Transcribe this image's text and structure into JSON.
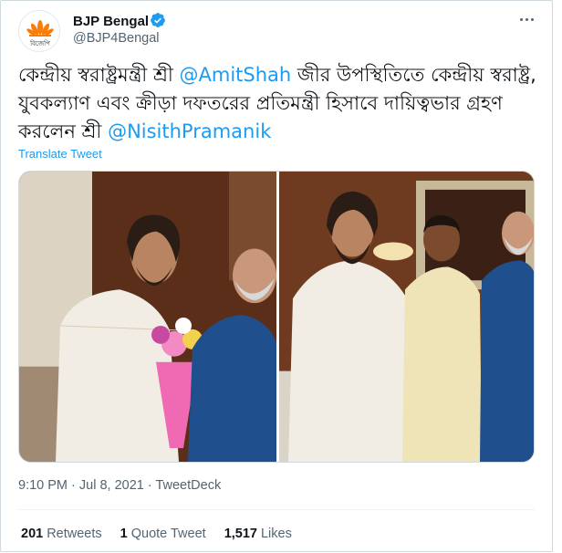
{
  "author": {
    "display_name": "BJP Bengal",
    "handle": "@BJP4Bengal",
    "avatar_text": "বিজেপি",
    "verified": true
  },
  "tweet": {
    "text_part1": "কেন্দ্রীয় স্বরাষ্ট্রমন্ত্রী শ্রী ",
    "mention1": "@AmitShah",
    "text_part2": " জীর উপস্থিতিতে কেন্দ্রীয় স্বরাষ্ট্র, যুবকল্যাণ এবং ক্রীড়া দফতরের প্রতিমন্ত্রী হিসাবে দায়িত্বভার গ্রহণ করলেন শ্রী ",
    "mention2": "@NisithPramanik",
    "translate_label": "Translate Tweet"
  },
  "meta": {
    "time": "9:10 PM",
    "sep1": " · ",
    "date": "Jul 8, 2021",
    "sep2": " · ",
    "source": "TweetDeck"
  },
  "stats": {
    "retweets_count": "201",
    "retweets_label": "Retweets",
    "quotes_count": "1",
    "quotes_label": "Quote Tweet",
    "likes_count": "1,517",
    "likes_label": "Likes"
  },
  "colors": {
    "accent": "#1d9bf0",
    "text": "#0f1419",
    "secondary": "#536471",
    "bjp_saffron": "#f97d09"
  }
}
